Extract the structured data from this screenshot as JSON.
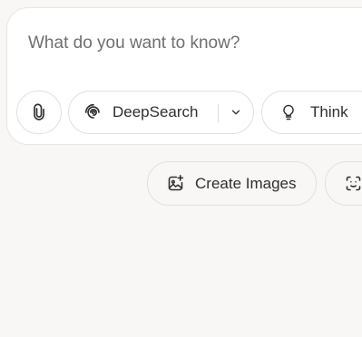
{
  "composer": {
    "placeholder": "What do you want to know?",
    "attach_icon": "paperclip-icon"
  },
  "toolbar": {
    "deepsearch_label": "DeepSearch",
    "deepsearch_icon": "swirl-icon",
    "deepsearch_menu_icon": "chevron-down-icon",
    "think_label": "Think",
    "think_icon": "lightbulb-icon"
  },
  "actions": {
    "create_images_label": "Create Images",
    "create_images_icon": "image-sparkle-icon",
    "next_icon": "face-scan-icon"
  }
}
